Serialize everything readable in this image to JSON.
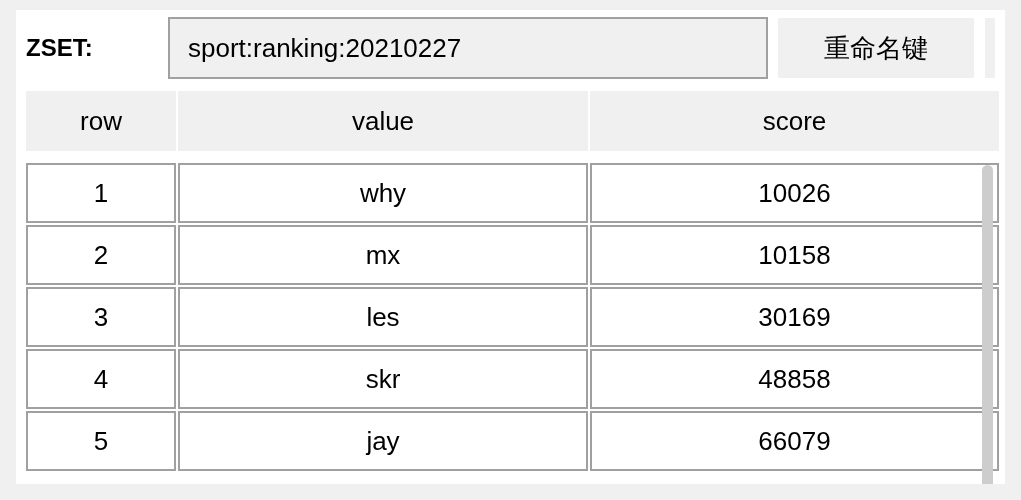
{
  "header": {
    "type_label": "ZSET:",
    "key_name": "sport:ranking:20210227",
    "rename_button": "重命名键"
  },
  "table": {
    "columns": [
      "row",
      "value",
      "score"
    ],
    "rows": [
      {
        "row": "1",
        "value": "why",
        "score": "10026"
      },
      {
        "row": "2",
        "value": "mx",
        "score": "10158"
      },
      {
        "row": "3",
        "value": "les",
        "score": "30169"
      },
      {
        "row": "4",
        "value": "skr",
        "score": "48858"
      },
      {
        "row": "5",
        "value": "jay",
        "score": "66079"
      }
    ]
  }
}
